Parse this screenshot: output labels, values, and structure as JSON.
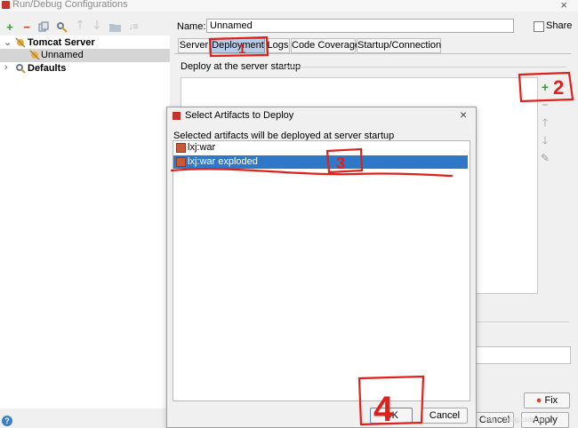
{
  "window": {
    "title": "Run/Debug Configurations",
    "close": "×"
  },
  "toolbar": {
    "icons": [
      "plus-icon",
      "minus-icon",
      "copy-icon",
      "wrench-icon",
      "arrow-up-icon",
      "arrow-down-icon",
      "folder-icon",
      "sort-icon"
    ]
  },
  "tree": {
    "items": [
      {
        "label": "Tomcat Server",
        "bold": true,
        "expanded": true
      },
      {
        "label": "Unnamed",
        "selected": true
      },
      {
        "label": "Defaults",
        "bold": true,
        "expanded": false
      }
    ]
  },
  "config": {
    "name_label": "Name:",
    "name_value": "Unnamed",
    "share_label": "Share",
    "tabs": [
      {
        "label": "Server"
      },
      {
        "label": "Deployment",
        "active": true
      },
      {
        "label": "Logs"
      },
      {
        "label": "Code Coverage"
      },
      {
        "label": "Startup/Connection"
      }
    ],
    "deploy_header": "Deploy at the server startup",
    "fix_label": "Fix",
    "cancel_label": "Cancel",
    "apply_label": "Apply"
  },
  "dialog": {
    "title": "Select Artifacts to Deploy",
    "close": "×",
    "description": "Selected artifacts will be deployed at server startup",
    "artifacts": [
      {
        "label": "lxj:war"
      },
      {
        "label": "lxj:war exploded",
        "selected": true
      }
    ],
    "ok_label": "OK",
    "cancel_label": "Cancel"
  },
  "annotations": [
    "1",
    "2",
    "3",
    "4"
  ],
  "watermark": "https://blog.csdn.net/...",
  "colors": {
    "selection": "#2f78c8",
    "tab_active": "#b6cbe6",
    "annotation": "#e0201b",
    "add_icon": "#3a9a3a"
  }
}
